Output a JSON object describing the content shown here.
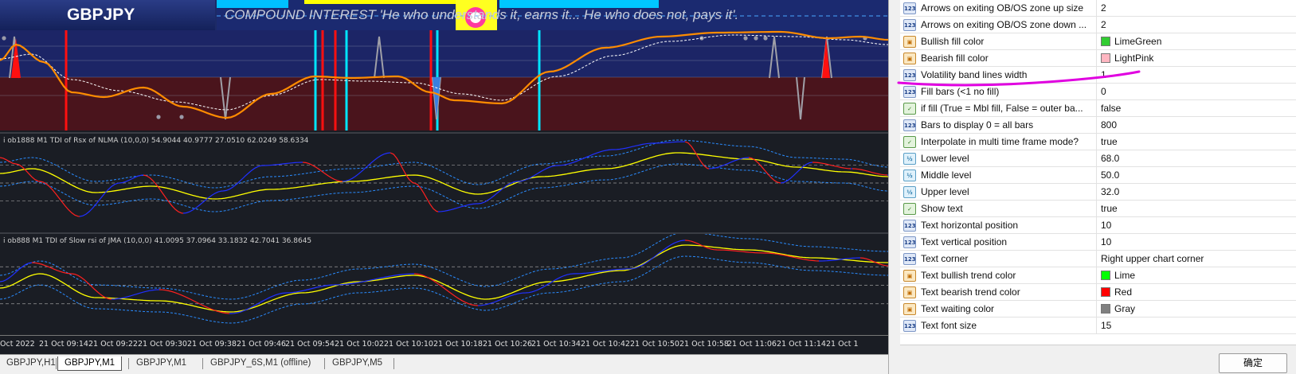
{
  "window": {
    "symbol": "GBPJPY",
    "banner": "COMPOUND INTEREST 'He who understands it, earns it... He who does not, pays it'."
  },
  "indicators": [
    {
      "label": "i ob1888 M1 TDI of Rsx of NLMA (10,0,0) 54.9044 40.9777 27.0510 62.0249 58.6334"
    },
    {
      "label": "i ob888 M1 TDI of Slow rsi of JMA (10,0,0) 41.0095 37.0964 33.1832 42.7041 36.8645"
    }
  ],
  "time_axis": [
    "Oct 2022",
    "21 Oct 09:14",
    "21 Oct 09:22",
    "21 Oct 09:30",
    "21 Oct 09:38",
    "21 Oct 09:46",
    "21 Oct 09:54",
    "21 Oct 10:02",
    "21 Oct 10:10",
    "21 Oct 10:18",
    "21 Oct 10:26",
    "21 Oct 10:34",
    "21 Oct 10:42",
    "21 Oct 10:50",
    "21 Oct 10:58",
    "21 Oct 11:06",
    "21 Oct 11:14",
    "21 Oct 1"
  ],
  "tabs": [
    {
      "label": "GBPJPY,H1",
      "active": false
    },
    {
      "label": "GBPJPY,M1",
      "active": true
    },
    {
      "label": "GBPJPY,M1",
      "active": false
    },
    {
      "label": "GBPJPY_6S,M1 (offline)",
      "active": false
    },
    {
      "label": "GBPJPY,M5",
      "active": false
    }
  ],
  "properties": [
    {
      "name": "Arrows on exiting OB/OS zone up size",
      "value": "2",
      "icon": "123",
      "type": "int"
    },
    {
      "name": "Arrows on exiting OB/OS zone down ...",
      "value": "2",
      "icon": "123",
      "type": "int"
    },
    {
      "name": "Bullish fill color",
      "value": "LimeGreen",
      "icon": "color",
      "type": "color",
      "swatch": "#32cd32"
    },
    {
      "name": "Bearish fill color",
      "value": "LightPink",
      "icon": "color",
      "type": "color",
      "swatch": "#ffb6c1"
    },
    {
      "name": "Volatility band lines width",
      "value": "1",
      "icon": "123",
      "type": "int"
    },
    {
      "name": "Fill bars (<1 no fill)",
      "value": "0",
      "icon": "123",
      "type": "int"
    },
    {
      "name": "if fill (True = Mbl fill, False = outer ba...",
      "value": "false",
      "icon": "bool",
      "type": "bool"
    },
    {
      "name": "Bars to display 0 = all bars",
      "value": "800",
      "icon": "123",
      "type": "int"
    },
    {
      "name": "Interpolate in multi time frame mode?",
      "value": "true",
      "icon": "bool",
      "type": "bool"
    },
    {
      "name": "Lower level",
      "value": "68.0",
      "icon": "dbl",
      "type": "double"
    },
    {
      "name": "Middle level",
      "value": "50.0",
      "icon": "dbl",
      "type": "double"
    },
    {
      "name": "Upper level",
      "value": "32.0",
      "icon": "dbl",
      "type": "double"
    },
    {
      "name": "Show text",
      "value": "true",
      "icon": "bool",
      "type": "bool"
    },
    {
      "name": "Text horizontal position",
      "value": "10",
      "icon": "123",
      "type": "int"
    },
    {
      "name": "Text vertical position",
      "value": "10",
      "icon": "123",
      "type": "int"
    },
    {
      "name": "Text corner",
      "value": "Right upper chart corner",
      "icon": "123",
      "type": "enum"
    },
    {
      "name": "Text bullish trend color",
      "value": "Lime",
      "icon": "color",
      "type": "color",
      "swatch": "#00ff00"
    },
    {
      "name": "Text bearish trend color",
      "value": "Red",
      "icon": "color",
      "type": "color",
      "swatch": "#ff0000"
    },
    {
      "name": "Text waiting color",
      "value": "Gray",
      "icon": "color",
      "type": "color",
      "swatch": "#808080"
    },
    {
      "name": "Text font size",
      "value": "15",
      "icon": "123",
      "type": "int"
    }
  ],
  "ok_button": "确定",
  "colors": {
    "chart_bg": "#1a1d24",
    "osc1_upper_bg": "#1c2566",
    "osc1_lower_bg": "#4a141c",
    "fast_line": "#ff8c00",
    "slow_line": "#ffffff",
    "signal_red": "#ff1010",
    "signal_cyan": "#00e5ff",
    "tdi_yellow": "#ffff00",
    "tdi_red": "#ff2020",
    "tdi_blue": "#2030ff",
    "band_blue": "#2a8cff",
    "annotation": "#e000e0"
  }
}
